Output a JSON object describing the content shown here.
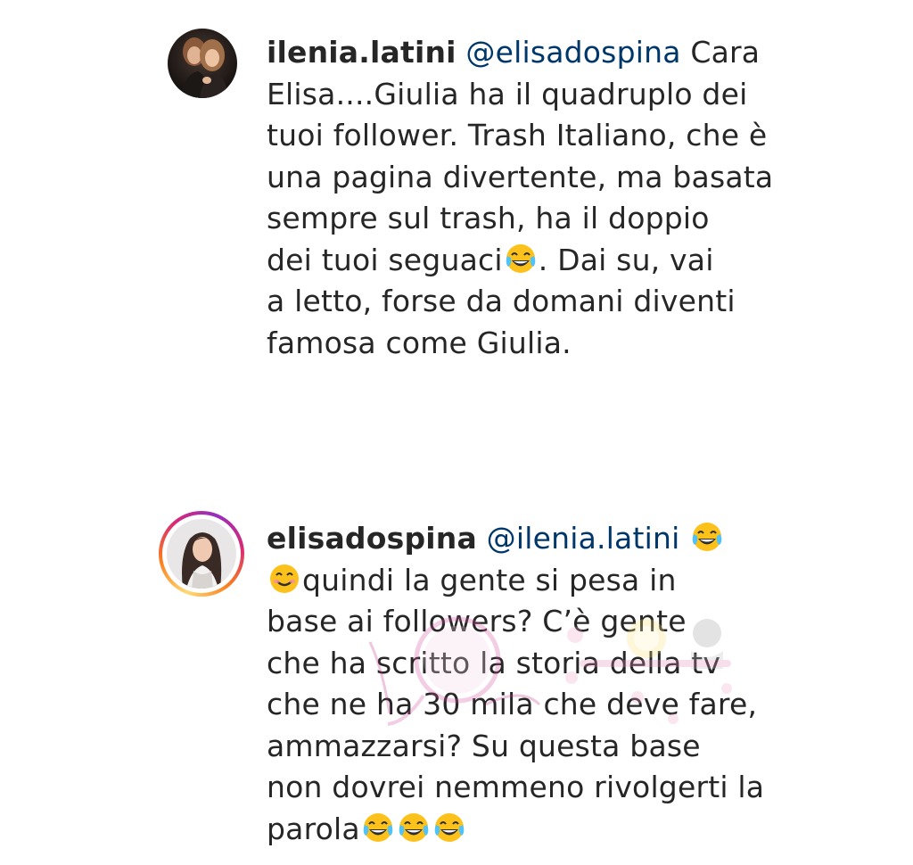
{
  "comments": [
    {
      "username": "ilenia.latini",
      "lines": {
        "l1_mention": "@elisadospina",
        "l1_rest": " Cara",
        "l2": "Elisa....Giulia ha il quadruplo dei",
        "l3": "tuoi follower. Trash Italiano, che è",
        "l4": "una pagina divertente, ma basata",
        "l5": "sempre sul trash, ha il doppio",
        "l6_a": "dei tuoi seguaci",
        "l6_b": ". Dai su, vai",
        "l7": "a letto, forse da domani diventi",
        "l8": "famosa come Giulia."
      },
      "emojis": [
        "face-with-tears-of-joy-icon"
      ]
    },
    {
      "username": "elisadospina",
      "lines": {
        "l1_mention": "@ilenia.latini",
        "l2": "quindi la gente si pesa in",
        "l3": "base ai followers? C’è gente",
        "l4": "che ha scritto la storia della tv",
        "l5": "che ne ha 30 mila che deve fare,",
        "l6": "ammazzarsi? Su questa base",
        "l7": "non dovrei nemmeno rivolgerti la",
        "l8": "parola"
      },
      "emojis": [
        "face-with-tears-of-joy-icon",
        "smiling-face-icon",
        "face-with-tears-of-joy-icon",
        "face-with-tears-of-joy-icon",
        "face-with-tears-of-joy-icon"
      ]
    }
  ],
  "colors": {
    "text": "#262626",
    "mention": "#00376b",
    "story_ring": [
      "#feda75",
      "#fa7e1e",
      "#d62976",
      "#962fbf"
    ]
  }
}
